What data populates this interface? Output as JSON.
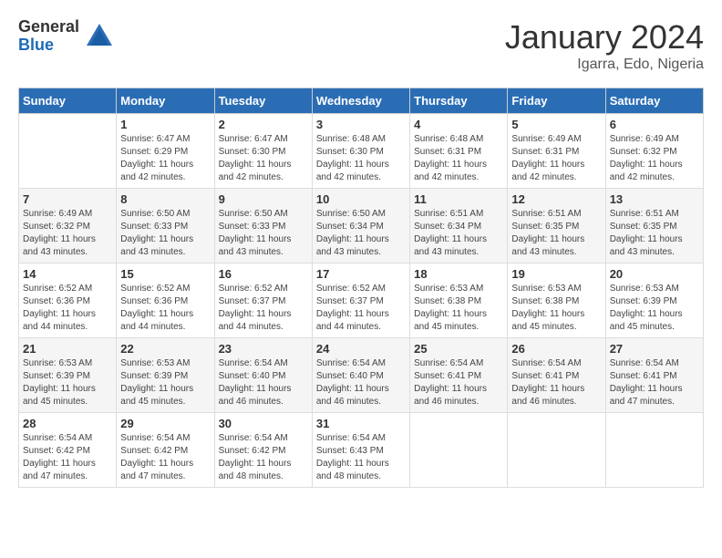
{
  "header": {
    "logo_general": "General",
    "logo_blue": "Blue",
    "calendar_title": "January 2024",
    "calendar_subtitle": "Igarra, Edo, Nigeria"
  },
  "weekdays": [
    "Sunday",
    "Monday",
    "Tuesday",
    "Wednesday",
    "Thursday",
    "Friday",
    "Saturday"
  ],
  "weeks": [
    [
      {
        "day": "",
        "info": ""
      },
      {
        "day": "1",
        "info": "Sunrise: 6:47 AM\nSunset: 6:29 PM\nDaylight: 11 hours and 42 minutes."
      },
      {
        "day": "2",
        "info": "Sunrise: 6:47 AM\nSunset: 6:30 PM\nDaylight: 11 hours and 42 minutes."
      },
      {
        "day": "3",
        "info": "Sunrise: 6:48 AM\nSunset: 6:30 PM\nDaylight: 11 hours and 42 minutes."
      },
      {
        "day": "4",
        "info": "Sunrise: 6:48 AM\nSunset: 6:31 PM\nDaylight: 11 hours and 42 minutes."
      },
      {
        "day": "5",
        "info": "Sunrise: 6:49 AM\nSunset: 6:31 PM\nDaylight: 11 hours and 42 minutes."
      },
      {
        "day": "6",
        "info": "Sunrise: 6:49 AM\nSunset: 6:32 PM\nDaylight: 11 hours and 42 minutes."
      }
    ],
    [
      {
        "day": "7",
        "info": "Sunrise: 6:49 AM\nSunset: 6:32 PM\nDaylight: 11 hours and 43 minutes."
      },
      {
        "day": "8",
        "info": "Sunrise: 6:50 AM\nSunset: 6:33 PM\nDaylight: 11 hours and 43 minutes."
      },
      {
        "day": "9",
        "info": "Sunrise: 6:50 AM\nSunset: 6:33 PM\nDaylight: 11 hours and 43 minutes."
      },
      {
        "day": "10",
        "info": "Sunrise: 6:50 AM\nSunset: 6:34 PM\nDaylight: 11 hours and 43 minutes."
      },
      {
        "day": "11",
        "info": "Sunrise: 6:51 AM\nSunset: 6:34 PM\nDaylight: 11 hours and 43 minutes."
      },
      {
        "day": "12",
        "info": "Sunrise: 6:51 AM\nSunset: 6:35 PM\nDaylight: 11 hours and 43 minutes."
      },
      {
        "day": "13",
        "info": "Sunrise: 6:51 AM\nSunset: 6:35 PM\nDaylight: 11 hours and 43 minutes."
      }
    ],
    [
      {
        "day": "14",
        "info": "Sunrise: 6:52 AM\nSunset: 6:36 PM\nDaylight: 11 hours and 44 minutes."
      },
      {
        "day": "15",
        "info": "Sunrise: 6:52 AM\nSunset: 6:36 PM\nDaylight: 11 hours and 44 minutes."
      },
      {
        "day": "16",
        "info": "Sunrise: 6:52 AM\nSunset: 6:37 PM\nDaylight: 11 hours and 44 minutes."
      },
      {
        "day": "17",
        "info": "Sunrise: 6:52 AM\nSunset: 6:37 PM\nDaylight: 11 hours and 44 minutes."
      },
      {
        "day": "18",
        "info": "Sunrise: 6:53 AM\nSunset: 6:38 PM\nDaylight: 11 hours and 45 minutes."
      },
      {
        "day": "19",
        "info": "Sunrise: 6:53 AM\nSunset: 6:38 PM\nDaylight: 11 hours and 45 minutes."
      },
      {
        "day": "20",
        "info": "Sunrise: 6:53 AM\nSunset: 6:39 PM\nDaylight: 11 hours and 45 minutes."
      }
    ],
    [
      {
        "day": "21",
        "info": "Sunrise: 6:53 AM\nSunset: 6:39 PM\nDaylight: 11 hours and 45 minutes."
      },
      {
        "day": "22",
        "info": "Sunrise: 6:53 AM\nSunset: 6:39 PM\nDaylight: 11 hours and 45 minutes."
      },
      {
        "day": "23",
        "info": "Sunrise: 6:54 AM\nSunset: 6:40 PM\nDaylight: 11 hours and 46 minutes."
      },
      {
        "day": "24",
        "info": "Sunrise: 6:54 AM\nSunset: 6:40 PM\nDaylight: 11 hours and 46 minutes."
      },
      {
        "day": "25",
        "info": "Sunrise: 6:54 AM\nSunset: 6:41 PM\nDaylight: 11 hours and 46 minutes."
      },
      {
        "day": "26",
        "info": "Sunrise: 6:54 AM\nSunset: 6:41 PM\nDaylight: 11 hours and 46 minutes."
      },
      {
        "day": "27",
        "info": "Sunrise: 6:54 AM\nSunset: 6:41 PM\nDaylight: 11 hours and 47 minutes."
      }
    ],
    [
      {
        "day": "28",
        "info": "Sunrise: 6:54 AM\nSunset: 6:42 PM\nDaylight: 11 hours and 47 minutes."
      },
      {
        "day": "29",
        "info": "Sunrise: 6:54 AM\nSunset: 6:42 PM\nDaylight: 11 hours and 47 minutes."
      },
      {
        "day": "30",
        "info": "Sunrise: 6:54 AM\nSunset: 6:42 PM\nDaylight: 11 hours and 48 minutes."
      },
      {
        "day": "31",
        "info": "Sunrise: 6:54 AM\nSunset: 6:43 PM\nDaylight: 11 hours and 48 minutes."
      },
      {
        "day": "",
        "info": ""
      },
      {
        "day": "",
        "info": ""
      },
      {
        "day": "",
        "info": ""
      }
    ]
  ]
}
